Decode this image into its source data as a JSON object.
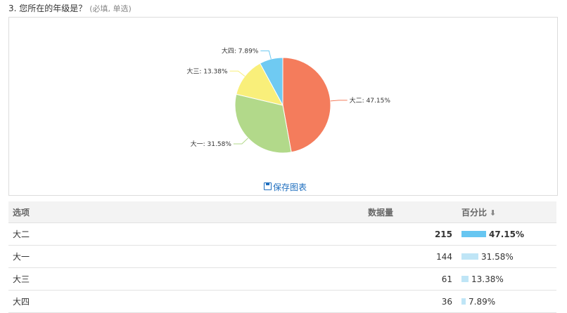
{
  "question": {
    "title": "3. 您所在的年级是？",
    "hint": "(必填, 单选)"
  },
  "chart_data": {
    "type": "pie",
    "categories": [
      "大二",
      "大一",
      "大三",
      "大四"
    ],
    "values": [
      47.15,
      31.58,
      13.38,
      7.89
    ],
    "labels": [
      "大二: 47.15%",
      "大一: 31.58%",
      "大三: 13.38%",
      "大四: 7.89%"
    ],
    "colors": [
      "#f47c5c",
      "#b2d98a",
      "#f9ef7a",
      "#6fcaf2"
    ]
  },
  "save_chart_label": "保存图表",
  "table": {
    "headers": {
      "option": "选项",
      "count": "数据量",
      "percent": "百分比"
    },
    "sort_icon": "arrow-down-icon",
    "rows": [
      {
        "option": "大二",
        "count": "215",
        "percent": "47.15%",
        "ratio": 0.4715
      },
      {
        "option": "大一",
        "count": "144",
        "percent": "31.58%",
        "ratio": 0.3158
      },
      {
        "option": "大三",
        "count": "61",
        "percent": "13.38%",
        "ratio": 0.1338
      },
      {
        "option": "大四",
        "count": "36",
        "percent": "7.89%",
        "ratio": 0.0789
      }
    ]
  }
}
